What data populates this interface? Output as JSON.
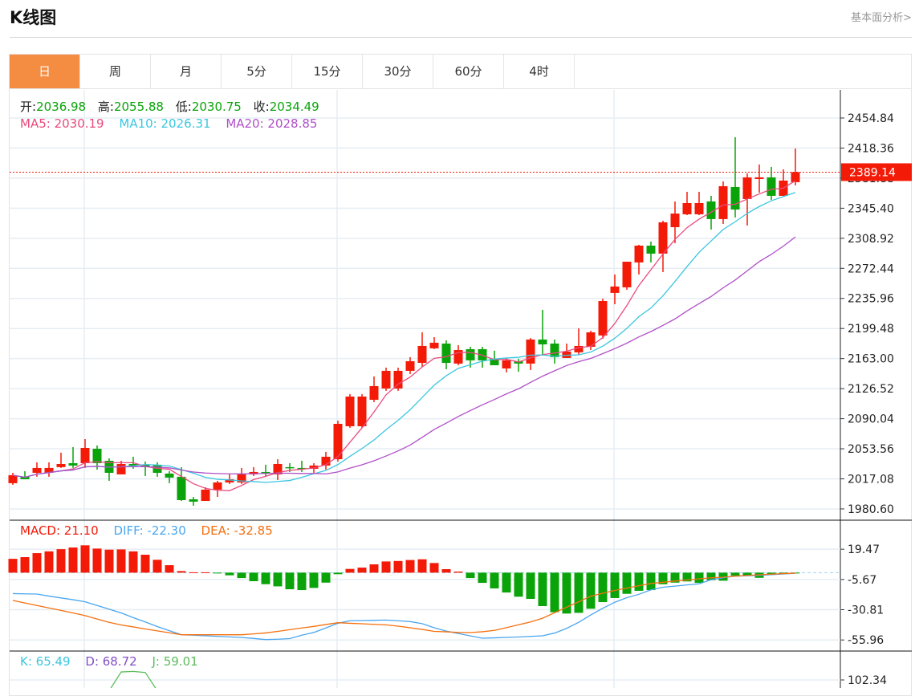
{
  "header": {
    "title": "K线图",
    "link": "基本面分析>"
  },
  "tabs": [
    {
      "label": "日",
      "active": true
    },
    {
      "label": "周"
    },
    {
      "label": "月"
    },
    {
      "label": "5分"
    },
    {
      "label": "15分"
    },
    {
      "label": "30分"
    },
    {
      "label": "60分"
    },
    {
      "label": "4时"
    }
  ],
  "colors": {
    "up": "#f41a08",
    "down": "#0aa30a",
    "ma5": "#ea4a7d",
    "ma10": "#3cc6e0",
    "ma20": "#b050c8",
    "diff": "#4aa6f0",
    "dea": "#f5700f",
    "macd": "#f41a08",
    "k": "#3cc6e0",
    "d": "#8050c8",
    "j": "#5cbc5c",
    "active_tab": "#f48c42"
  },
  "ohlc_legend": {
    "open_label": "开:",
    "open": "2036.98",
    "high_label": "高:",
    "high": "2055.88",
    "low_label": "低:",
    "low": "2030.75",
    "close_label": "收:",
    "close": "2034.49"
  },
  "ma_legend": {
    "ma5": "MA5: 2030.19",
    "ma10": "MA10: 2026.31",
    "ma20": "MA20: 2028.85"
  },
  "macd_legend": {
    "macd": "MACD: 21.10",
    "diff": "DIFF: -22.30",
    "dea": "DEA: -32.85"
  },
  "kdj_legend": {
    "k": "K: 65.49",
    "d": "D: 68.72",
    "j": "J: 59.01"
  },
  "chart_data": [
    {
      "type": "candlestick",
      "title": "",
      "ylim": [
        1967.9,
        2488.9
      ],
      "yticks": [
        "2454.84",
        "2418.36",
        "2381.88",
        "2345.40",
        "2308.92",
        "2272.44",
        "2235.96",
        "2199.48",
        "2163.00",
        "2126.52",
        "2090.04",
        "2053.56",
        "2017.08",
        "1980.60"
      ],
      "current_price": "2389.14",
      "ma_periods": [
        5,
        10,
        20
      ],
      "candles": [
        [
          2011.8,
          2024.4,
          2009.8,
          2021.5
        ],
        [
          2019.6,
          2026.4,
          2016.6,
          2016.6
        ],
        [
          2024.4,
          2037.1,
          2019.6,
          2030.3
        ],
        [
          2024.4,
          2037.1,
          2019.6,
          2030.3
        ],
        [
          2031.3,
          2048.8,
          2030.3,
          2035.1
        ],
        [
          2036.1,
          2055.6,
          2030.3,
          2033.2
        ],
        [
          2036.1,
          2065.3,
          2030.3,
          2054.6
        ],
        [
          2053.6,
          2057.6,
          2028.3,
          2036.1
        ],
        [
          2039.0,
          2041.9,
          2014.7,
          2024.4
        ],
        [
          2022.5,
          2039.0,
          2022.5,
          2035.1
        ],
        [
          2035.1,
          2043.9,
          2029.3,
          2033.2
        ],
        [
          2034.2,
          2038.1,
          2020.5,
          2032.2
        ],
        [
          2034.2,
          2037.1,
          2019.6,
          2024.4
        ],
        [
          2023.5,
          2026.4,
          2011.8,
          2018.6
        ],
        [
          2019.6,
          2031.3,
          1990.3,
          1991.3
        ],
        [
          1992.3,
          1995.2,
          1984.5,
          1989.4
        ],
        [
          1990.3,
          2006.9,
          1990.3,
          2004.0
        ],
        [
          2004.0,
          2014.7,
          1995.2,
          2012.7
        ],
        [
          2012.7,
          2022.5,
          2010.8,
          2016.6
        ],
        [
          2012.7,
          2030.3,
          2010.8,
          2022.5
        ],
        [
          2022.5,
          2031.3,
          2020.5,
          2025.4
        ],
        [
          2025.4,
          2034.2,
          2020.5,
          2023.5
        ],
        [
          2022.5,
          2040.9,
          2015.7,
          2035.1
        ],
        [
          2031.3,
          2036.1,
          2025.4,
          2030.3
        ],
        [
          2030.3,
          2039.0,
          2025.4,
          2029.3
        ],
        [
          2029.3,
          2036.1,
          2024.4,
          2033.2
        ],
        [
          2033.2,
          2049.8,
          2028.3,
          2043.9
        ],
        [
          2040.9,
          2087.7,
          2038.1,
          2083.8
        ],
        [
          2080.9,
          2119.9,
          2079.0,
          2116.9
        ],
        [
          2080.9,
          2119.9,
          2079.0,
          2116.9
        ],
        [
          2113.0,
          2141.3,
          2110.1,
          2129.6
        ],
        [
          2126.7,
          2152.0,
          2123.8,
          2148.1
        ],
        [
          2126.7,
          2152.0,
          2123.8,
          2148.1
        ],
        [
          2148.1,
          2164.7,
          2144.2,
          2159.8
        ],
        [
          2157.8,
          2194.8,
          2152.9,
          2178.3
        ],
        [
          2175.4,
          2189.0,
          2174.4,
          2182.2
        ],
        [
          2181.2,
          2185.1,
          2150.1,
          2157.8
        ],
        [
          2156.9,
          2179.3,
          2154.9,
          2173.4
        ],
        [
          2174.4,
          2177.3,
          2152.0,
          2160.8
        ],
        [
          2174.4,
          2177.3,
          2152.0,
          2160.8
        ],
        [
          2162.7,
          2172.5,
          2154.9,
          2154.9
        ],
        [
          2151.0,
          2163.7,
          2146.2,
          2160.8
        ],
        [
          2159.8,
          2162.7,
          2147.1,
          2156.9
        ],
        [
          2156.9,
          2188.0,
          2149.1,
          2186.1
        ],
        [
          2186.1,
          2222.1,
          2166.6,
          2180.2
        ],
        [
          2181.2,
          2186.1,
          2156.9,
          2164.7
        ],
        [
          2163.7,
          2181.2,
          2163.7,
          2171.5
        ],
        [
          2170.5,
          2199.7,
          2167.6,
          2178.3
        ],
        [
          2177.3,
          2196.8,
          2173.4,
          2194.8
        ],
        [
          2191.0,
          2235.7,
          2187.1,
          2232.8
        ],
        [
          2242.6,
          2265.0,
          2228.9,
          2250.4
        ],
        [
          2249.4,
          2280.5,
          2246.5,
          2280.5
        ],
        [
          2279.6,
          2301.0,
          2265.0,
          2300.0
        ],
        [
          2300.0,
          2304.9,
          2279.6,
          2290.3
        ],
        [
          2290.3,
          2330.2,
          2267.9,
          2328.3
        ],
        [
          2322.4,
          2353.6,
          2303.0,
          2338.9
        ],
        [
          2338.0,
          2365.3,
          2337.0,
          2351.6
        ],
        [
          2338.0,
          2365.3,
          2337.0,
          2351.6
        ],
        [
          2353.6,
          2360.4,
          2319.5,
          2332.2
        ],
        [
          2332.2,
          2377.9,
          2326.3,
          2372.1
        ],
        [
          2371.1,
          2431.5,
          2334.1,
          2343.8
        ],
        [
          2356.5,
          2387.7,
          2324.4,
          2382.8
        ],
        [
          2380.8,
          2398.4,
          2364.3,
          2382.8
        ],
        [
          2382.8,
          2395.5,
          2355.5,
          2360.4
        ],
        [
          2360.4,
          2392.5,
          2360.4,
          2378.9
        ],
        [
          2377.0,
          2417.8,
          2373.1,
          2389.14
        ]
      ]
    },
    {
      "type": "macd",
      "ylim": [
        -64.5,
        43.6
      ],
      "yticks": [
        "19.47",
        "-5.67",
        "-30.81",
        "-55.96"
      ],
      "macd": [
        11.5,
        12.9,
        16.2,
        17.7,
        19.5,
        20.9,
        22.7,
        20,
        19.1,
        19.3,
        17.7,
        14.9,
        10.7,
        6.2,
        1.3,
        0.3,
        0.3,
        -0.3,
        -2.2,
        -4.5,
        -7.1,
        -9.6,
        -11.4,
        -13.8,
        -14.5,
        -12.7,
        -8.3,
        -1.3,
        3.1,
        4.2,
        6.9,
        9.3,
        9.7,
        10.5,
        11.1,
        8.0,
        2.9,
        0.9,
        -4.5,
        -8.5,
        -13.1,
        -16.5,
        -20.0,
        -21.8,
        -27.8,
        -32.9,
        -34.0,
        -33.4,
        -30.0,
        -24.5,
        -21.1,
        -17.6,
        -15.1,
        -14.5,
        -9.6,
        -8.3,
        -7.3,
        -8.5,
        -6.3,
        -6.7,
        -2.5,
        -2.5,
        -4.3,
        -1.8,
        -0.7,
        -0.3
      ],
      "diff": [
        -17.4,
        -17.6,
        -17.8,
        -19.5,
        -21,
        -22.5,
        -24.2,
        -27.3,
        -30.4,
        -33.5,
        -37.4,
        -41,
        -44.8,
        -48.2,
        -51.6,
        -52,
        -52.5,
        -53,
        -53.4,
        -53.9,
        -54.7,
        -55.6,
        -55.3,
        -54.8,
        -52,
        -49.7,
        -46,
        -42.1,
        -40,
        -39.8,
        -39.6,
        -39.4,
        -40,
        -40.7,
        -42.4,
        -45.8,
        -48.6,
        -50.6,
        -52.6,
        -54.5,
        -54.2,
        -53.8,
        -53.5,
        -53,
        -52.5,
        -50.2,
        -46.3,
        -41.3,
        -35.2,
        -29.6,
        -24.6,
        -20.8,
        -18,
        -14.3,
        -12.1,
        -11.2,
        -10.2,
        -9.3,
        -5.9,
        -4.3,
        -2.9,
        -2.6,
        -2.3,
        -1.7,
        -1.1,
        -0.5
      ],
      "dea": [
        -23.1,
        -25.2,
        -27.3,
        -29.4,
        -31.4,
        -33.5,
        -35.7,
        -38.6,
        -41.3,
        -43.5,
        -45.1,
        -46.8,
        -48.4,
        -50,
        -51.6,
        -51.6,
        -51.6,
        -51.6,
        -51.6,
        -51.6,
        -50.9,
        -50.1,
        -48.8,
        -47.4,
        -46,
        -44.7,
        -43.1,
        -41.6,
        -42.1,
        -42.5,
        -43,
        -43.4,
        -44.5,
        -45.8,
        -47.2,
        -48.8,
        -49.2,
        -49.7,
        -49.8,
        -49.1,
        -48,
        -45.7,
        -43.3,
        -41,
        -37.9,
        -33.3,
        -28.7,
        -24.2,
        -19.6,
        -17.1,
        -14.8,
        -12.9,
        -10.9,
        -9,
        -8,
        -7,
        -6.1,
        -5.1,
        -4.3,
        -3.8,
        -2.9,
        -2.3,
        -1.8,
        -1.3,
        -0.8,
        -0.4
      ]
    },
    {
      "type": "kdj",
      "yticks": [
        "102.34"
      ],
      "j_visible": {
        "start_index": 8,
        "values": [
          92,
          110,
          110.5,
          109.5,
          92
        ]
      }
    }
  ]
}
